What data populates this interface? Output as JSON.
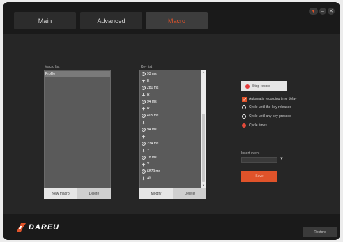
{
  "tabs": [
    {
      "label": "Main"
    },
    {
      "label": "Advanced"
    },
    {
      "label": "Macro"
    }
  ],
  "window_controls": {
    "dropdown": "▼",
    "minimize": "–",
    "close": "✕"
  },
  "macro_list": {
    "label": "Macro list",
    "items": [
      "Profile"
    ],
    "new_label": "New macro",
    "delete_label": "Delete"
  },
  "key_list": {
    "label": "Key list",
    "items": [
      {
        "icon": "timer-icon",
        "text": "93 ms"
      },
      {
        "icon": "key-up-icon",
        "text": "E"
      },
      {
        "icon": "timer-icon",
        "text": "281 ms"
      },
      {
        "icon": "key-down-icon",
        "text": "R"
      },
      {
        "icon": "timer-icon",
        "text": "94 ms"
      },
      {
        "icon": "key-up-icon",
        "text": "R"
      },
      {
        "icon": "timer-icon",
        "text": "405 ms"
      },
      {
        "icon": "key-down-icon",
        "text": "T"
      },
      {
        "icon": "timer-icon",
        "text": "94 ms"
      },
      {
        "icon": "key-up-icon",
        "text": "T"
      },
      {
        "icon": "timer-icon",
        "text": "234 ms"
      },
      {
        "icon": "key-down-icon",
        "text": "Y"
      },
      {
        "icon": "timer-icon",
        "text": "78 ms"
      },
      {
        "icon": "key-up-icon",
        "text": "Y"
      },
      {
        "icon": "timer-icon",
        "text": "6879 ms"
      },
      {
        "icon": "key-down-icon",
        "text": "Alt"
      }
    ],
    "modify_label": "Modify",
    "delete_label": "Delete"
  },
  "record": {
    "stop_label": "Stop record",
    "auto_delay_label": "Automatic recording time delay",
    "options": [
      {
        "label": "Cycle until the key released",
        "selected": false
      },
      {
        "label": "Cycle until any key pressed",
        "selected": false
      },
      {
        "label": "Cycle times",
        "selected": true
      }
    ]
  },
  "insert_event": {
    "label": "Insert event",
    "arrow": "▼",
    "save_label": "Save"
  },
  "footer": {
    "logo_text": "DAREU",
    "restore_label": "Restore"
  },
  "colors": {
    "accent": "#e0532a",
    "record_dot": "#e23a3a",
    "panel": "#262626",
    "list_bg": "#5a5a5a"
  }
}
